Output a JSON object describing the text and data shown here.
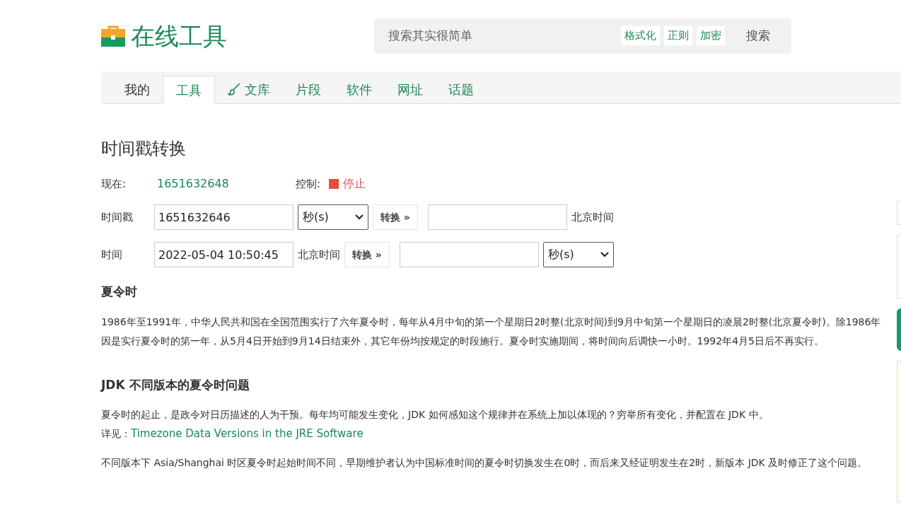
{
  "logo": {
    "text": "在线工具"
  },
  "search": {
    "placeholder": "搜索其实很简单",
    "tags": [
      "格式化",
      "正则",
      "加密"
    ],
    "button": "搜索"
  },
  "nav": [
    {
      "label": "我的",
      "selected": false,
      "icon": false
    },
    {
      "label": "工具",
      "selected": true,
      "icon": false
    },
    {
      "label": "文库",
      "selected": false,
      "icon": true
    },
    {
      "label": "片段",
      "selected": false,
      "icon": false
    },
    {
      "label": "软件",
      "selected": false,
      "icon": false
    },
    {
      "label": "网址",
      "selected": false,
      "icon": false
    },
    {
      "label": "话题",
      "selected": false,
      "icon": false
    }
  ],
  "page_title": "时间戳转换",
  "now": {
    "label": "现在:",
    "value": "1651632648",
    "control_label": "控制:",
    "control_action": "停止"
  },
  "row1": {
    "label": "时间戳",
    "value": "1651632646",
    "unit": "秒(s)",
    "button": "转换 »",
    "suffix": "北京时间"
  },
  "row2": {
    "label": "时间",
    "value": "2022-05-04 10:50:45",
    "zone": "北京时间",
    "button": "转换 »",
    "unit": "秒(s)"
  },
  "sections": [
    {
      "heading": "夏令时",
      "paragraphs": [
        {
          "text": "1986年至1991年，中华人民共和国在全国范围实行了六年夏令时，每年从4月中旬的第一个星期日2时整(北京时间)到9月中旬第一个星期日的凌晨2时整(北京夏令时)。除1986年因是实行夏令时的第一年，从5月4日开始到9月14日结束外，其它年份均按规定的时段施行。夏令时实施期间，将时间向后调快一小时。1992年4月5日后不再实行。"
        }
      ]
    },
    {
      "heading": "JDK 不同版本的夏令时问题",
      "paragraphs": [
        {
          "text": "夏令时的起止，是政令对日历描述的人为干预。每年均可能发生变化，JDK 如何感知这个规律并在系统上加以体现的？穷举所有变化，并配置在 JDK 中。",
          "link_label": "详见：",
          "link": "Timezone Data Versions in the JRE Software"
        },
        {
          "text": "不同版本下 Asia/Shanghai 时区夏令时起始时间不同，早期维护者认为中国标准时间的夏令时切换发生在0时，而后来又经证明发生在2时，新版本 JDK 及时修正了这个问题。"
        }
      ]
    }
  ]
}
